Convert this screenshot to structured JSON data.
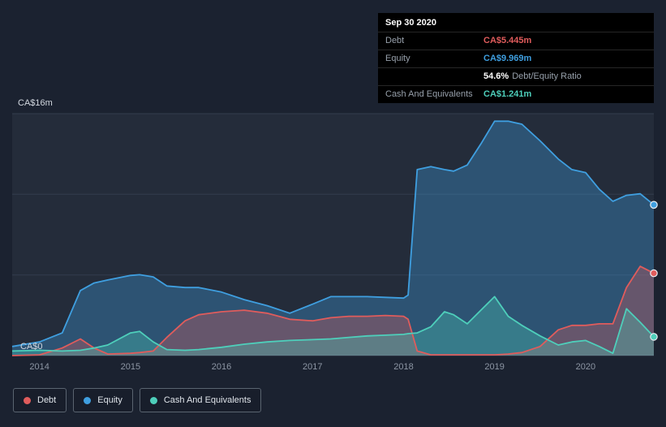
{
  "tooltip": {
    "date": "Sep 30 2020",
    "debt_label": "Debt",
    "debt_value": "CA$5.445m",
    "equity_label": "Equity",
    "equity_value": "CA$9.969m",
    "ratio_value": "54.6%",
    "ratio_label": "Debt/Equity Ratio",
    "cash_label": "Cash And Equivalents",
    "cash_value": "CA$1.241m"
  },
  "axis": {
    "y_top": "CA$16m",
    "y_bottom": "CA$0"
  },
  "legend": {
    "items": [
      {
        "label": "Debt",
        "color": "#e05c5c"
      },
      {
        "label": "Equity",
        "color": "#3f9fe0"
      },
      {
        "label": "Cash And Equivalents",
        "color": "#4ecfbb"
      }
    ]
  },
  "colors": {
    "page_background": "#1b2230",
    "plot_background": "#242c3a",
    "gridline": "#333d4d",
    "zero_line": "#3d4757",
    "tooltip_background": "#000000",
    "debt": "#e05c5c",
    "equity": "#3f9fe0",
    "cash": "#4ecfbb"
  },
  "chart_data": {
    "type": "area",
    "x": [
      2013.7,
      2014.0,
      2014.25,
      2014.45,
      2014.6,
      2014.75,
      2015.0,
      2015.1,
      2015.25,
      2015.4,
      2015.6,
      2015.75,
      2016.0,
      2016.25,
      2016.5,
      2016.75,
      2017.0,
      2017.2,
      2017.4,
      2017.6,
      2017.8,
      2018.0,
      2018.05,
      2018.15,
      2018.3,
      2018.45,
      2018.55,
      2018.7,
      2018.85,
      2019.0,
      2019.15,
      2019.3,
      2019.5,
      2019.7,
      2019.85,
      2020.0,
      2020.15,
      2020.3,
      2020.45,
      2020.6,
      2020.75
    ],
    "series": [
      {
        "name": "Equity",
        "color": "#3f9fe0",
        "fill_opacity": 0.35,
        "values": [
          0.6,
          0.9,
          1.5,
          4.3,
          4.8,
          5.0,
          5.3,
          5.35,
          5.2,
          4.6,
          4.5,
          4.5,
          4.2,
          3.7,
          3.3,
          2.8,
          3.4,
          3.9,
          3.9,
          3.9,
          3.85,
          3.8,
          4.0,
          12.3,
          12.5,
          12.3,
          12.2,
          12.6,
          14.0,
          15.5,
          15.5,
          15.3,
          14.2,
          13.0,
          12.3,
          12.1,
          11.0,
          10.2,
          10.6,
          10.7,
          9.969
        ]
      },
      {
        "name": "Debt",
        "color": "#e05c5c",
        "fill_opacity": 0.32,
        "values": [
          0.0,
          0.05,
          0.5,
          1.1,
          0.5,
          0.1,
          0.15,
          0.2,
          0.3,
          1.2,
          2.3,
          2.7,
          2.9,
          3.0,
          2.8,
          2.4,
          2.3,
          2.5,
          2.6,
          2.6,
          2.65,
          2.6,
          2.4,
          0.3,
          0.05,
          0.05,
          0.05,
          0.05,
          0.05,
          0.05,
          0.1,
          0.2,
          0.6,
          1.7,
          2.0,
          2.0,
          2.1,
          2.1,
          4.5,
          5.9,
          5.445
        ]
      },
      {
        "name": "Cash And Equivalents",
        "color": "#4ecfbb",
        "fill_opacity": 0.32,
        "values": [
          0.3,
          0.35,
          0.3,
          0.35,
          0.5,
          0.7,
          1.5,
          1.6,
          0.9,
          0.4,
          0.35,
          0.4,
          0.55,
          0.75,
          0.9,
          1.0,
          1.05,
          1.1,
          1.2,
          1.3,
          1.35,
          1.4,
          1.45,
          1.5,
          1.9,
          2.9,
          2.7,
          2.1,
          3.0,
          3.9,
          2.6,
          2.0,
          1.3,
          0.7,
          0.9,
          1.0,
          0.6,
          0.15,
          3.1,
          2.2,
          1.241
        ]
      }
    ],
    "xlim": [
      2013.7,
      2020.75
    ],
    "ylim": [
      0,
      16
    ],
    "y_gridlines": [
      0,
      5.333,
      10.667,
      16
    ],
    "x_ticks": [
      2014,
      2015,
      2016,
      2017,
      2018,
      2019,
      2020
    ],
    "y_tick_labels": {
      "top": "CA$16m",
      "bottom": "CA$0"
    },
    "legend_position": "bottom-left",
    "grid": true,
    "last_point": {
      "date": "Sep 30 2020",
      "Debt": 5.445,
      "Equity": 9.969,
      "Cash And Equivalents": 1.241,
      "debt_equity_ratio": "54.6%"
    }
  }
}
